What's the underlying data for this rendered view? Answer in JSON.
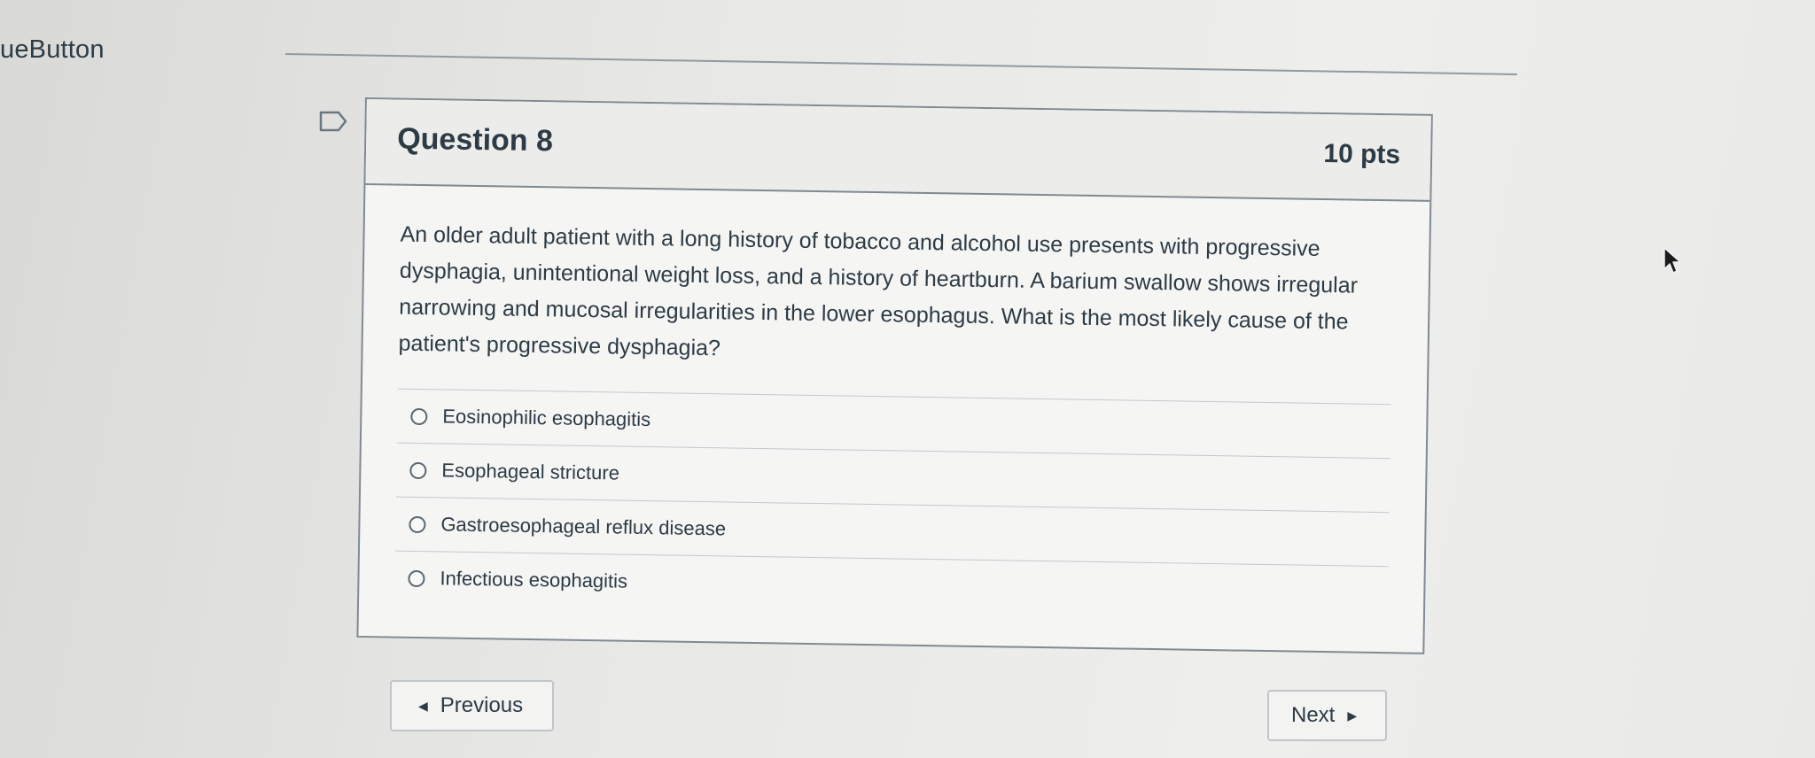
{
  "page": {
    "top_label": "ueButton"
  },
  "question": {
    "title": "Question 8",
    "points": "10 pts",
    "text": "An older adult patient with a long history of tobacco and alcohol use presents with progressive dysphagia, unintentional weight loss, and a history of heartburn. A barium swallow shows irregular narrowing and mucosal irregularities in the lower esophagus. What is the most likely cause of the patient's progressive dysphagia?",
    "answers": [
      {
        "label": "Eosinophilic esophagitis",
        "selected": false
      },
      {
        "label": "Esophageal stricture",
        "selected": false
      },
      {
        "label": "Gastroesophageal reflux disease",
        "selected": false
      },
      {
        "label": "Infectious esophagitis",
        "selected": false
      }
    ]
  },
  "navigation": {
    "previous_label": "Previous",
    "next_label": "Next"
  },
  "icons": {
    "flag": "flag-question-icon",
    "prev": "caret-left-icon",
    "next": "caret-right-icon",
    "cursor": "mouse-cursor-icon"
  }
}
